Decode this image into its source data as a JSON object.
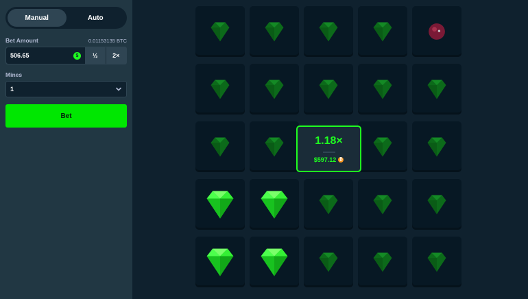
{
  "sidebar": {
    "tabs": [
      {
        "label": "Manual",
        "active": true
      },
      {
        "label": "Auto",
        "active": false
      }
    ],
    "bet_amount_label": "Bet Amount",
    "bet_amount_crypto": "0.01153135 BTC",
    "bet_amount_value": "506.65",
    "currency_icon": "dollar-coin-icon",
    "half_label": "½",
    "double_label": "2×",
    "mines_label": "Mines",
    "mines_value": "1",
    "bet_button_label": "Bet"
  },
  "board": {
    "rows": 5,
    "cols": 5,
    "tiles": [
      [
        "gem-dim",
        "gem-dim",
        "gem-dim",
        "gem-dim",
        "mine-dim"
      ],
      [
        "gem-dim",
        "gem-dim",
        "gem-dim",
        "gem-dim",
        "gem-dim"
      ],
      [
        "gem-dim",
        "gem-dim",
        "multiplier",
        "gem-dim",
        "gem-dim"
      ],
      [
        "gem-bright",
        "gem-bright",
        "gem-dim",
        "gem-dim",
        "gem-dim"
      ],
      [
        "gem-bright",
        "gem-bright",
        "gem-dim",
        "gem-dim",
        "gem-dim"
      ]
    ]
  },
  "multiplier_card": {
    "value": "1.18×",
    "amount": "$597.12",
    "currency_icon": "btc-coin-icon"
  },
  "colors": {
    "accent": "#1fff20",
    "bg": "#0f212e",
    "sidebar": "#213743",
    "tile": "#071824"
  }
}
